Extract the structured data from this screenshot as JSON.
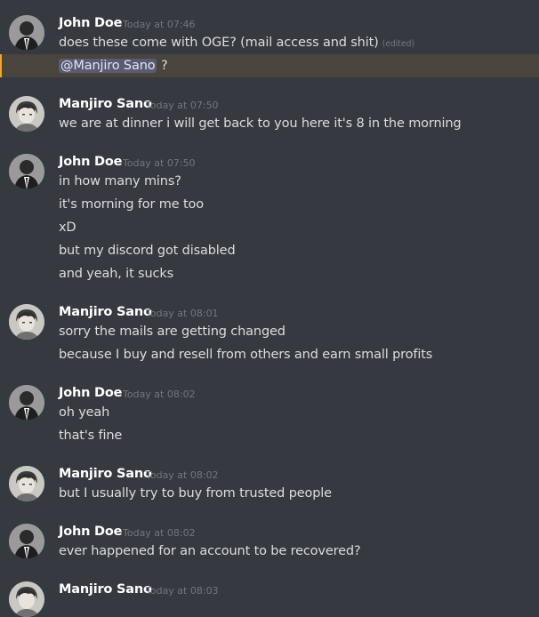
{
  "users": {
    "john": {
      "name": "John Doe"
    },
    "manjiro": {
      "name": "Manjiro Sano"
    }
  },
  "messages": [
    {
      "author": "John Doe",
      "timestamp": "Today at 07:46",
      "lines": [
        "does these come with OGE? (mail access and shit)"
      ],
      "edited_label": "(edited)",
      "mention": "@Manjiro Sano",
      "mention_suffix": "?"
    },
    {
      "author": "Manjiro Sano",
      "timestamp": "Today at 07:50",
      "lines": [
        "we are at dinner i will get back to you here it's 8 in the morning"
      ]
    },
    {
      "author": "John Doe",
      "timestamp": "Today at 07:50",
      "lines": [
        "in how many mins?",
        "it's morning for me too",
        "xD",
        "but my discord got disabled",
        "and yeah, it sucks"
      ]
    },
    {
      "author": "Manjiro Sano",
      "timestamp": "Today at 08:01",
      "lines": [
        "sorry the mails are getting changed",
        "because I buy and resell from others and earn small profits"
      ]
    },
    {
      "author": "John Doe",
      "timestamp": "Today at 08:02",
      "lines": [
        "oh yeah",
        "that's fine"
      ]
    },
    {
      "author": "Manjiro Sano",
      "timestamp": "Today at 08:02",
      "lines": [
        "but I usually try to buy from trusted people"
      ]
    },
    {
      "author": "John Doe",
      "timestamp": "Today at 08:02",
      "lines": [
        "ever happened for an account to be recovered?"
      ]
    },
    {
      "author": "Manjiro Sano",
      "timestamp": "Today at 08:03",
      "lines": []
    }
  ],
  "colors": {
    "background": "#36393f",
    "mention_highlight": "#49443c",
    "mention_accent": "#faa61a",
    "timestamp": "#72767d"
  }
}
